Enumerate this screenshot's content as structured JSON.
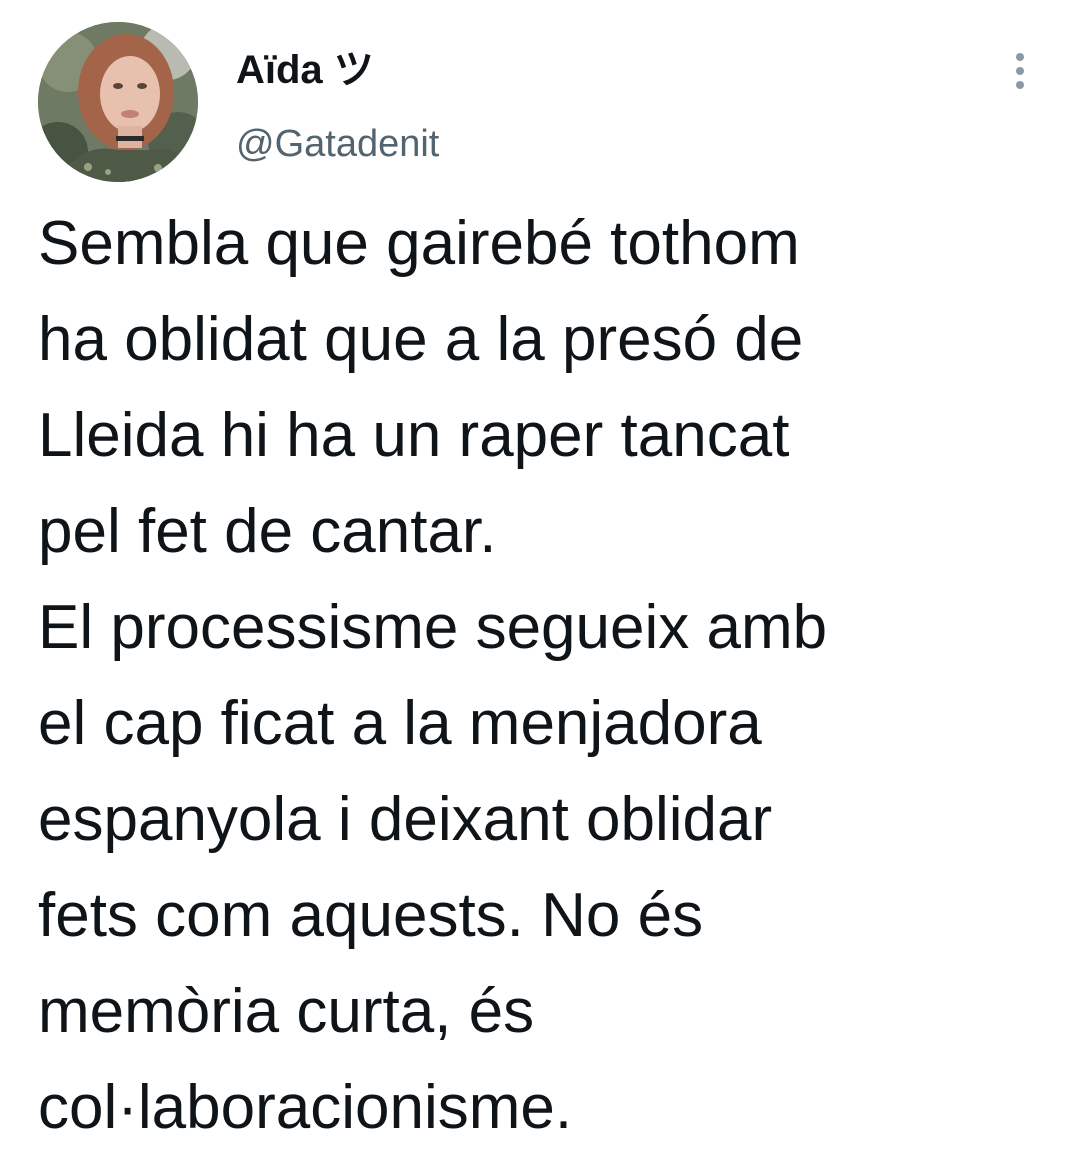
{
  "tweet": {
    "author": {
      "display_name": "Aïda ツ",
      "handle": "@Gatadenit",
      "avatar_icon": "profile-photo"
    },
    "more_icon": "more-options-icon",
    "text_lines": [
      "Sembla que gairebé tothom",
      "ha oblidat que a la presó de",
      "Lleida hi ha un raper tancat",
      "pel fet de cantar.",
      "El processisme segueix amb",
      "el cap ficat a la menjadora",
      "espanyola i deixant oblidar",
      "fets com aquests. No és",
      "memòria curta, és",
      "col·laboracionisme."
    ]
  },
  "colors": {
    "text": "#0f1419",
    "secondary_text": "#536471",
    "icon_gray": "#8b98a5",
    "background": "#ffffff"
  }
}
